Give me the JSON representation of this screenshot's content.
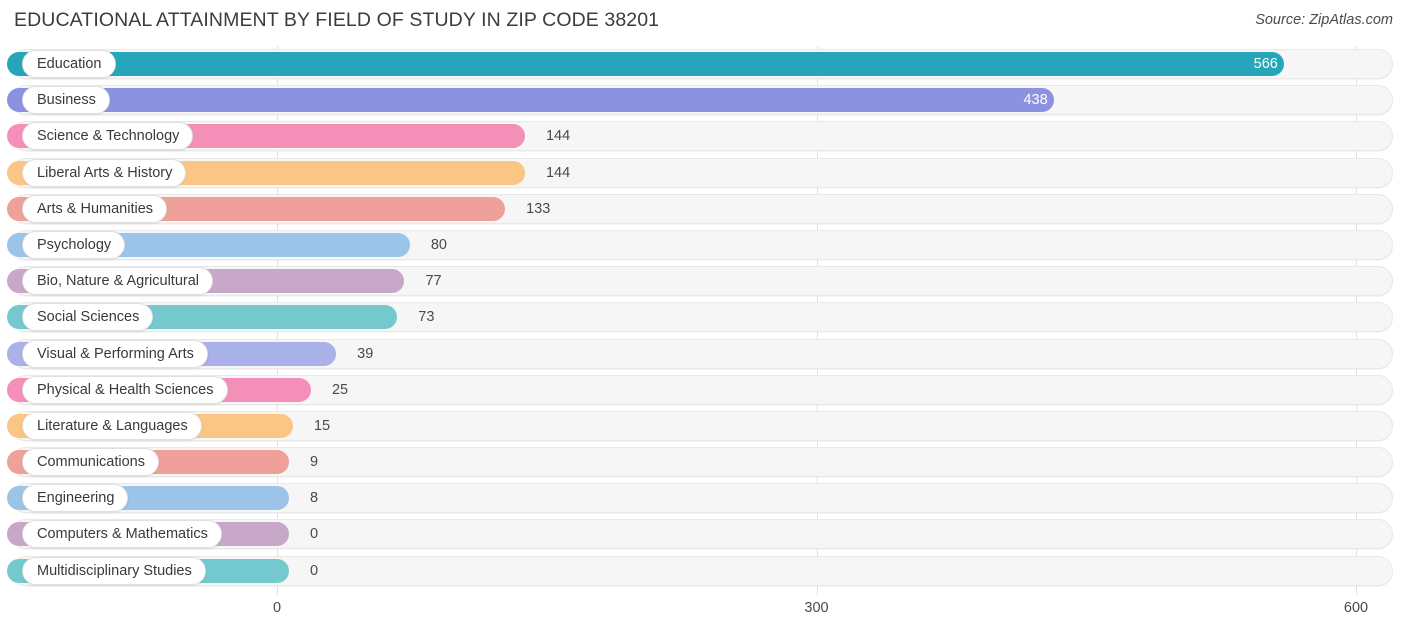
{
  "header": {
    "title": "EDUCATIONAL ATTAINMENT BY FIELD OF STUDY IN ZIP CODE 38201",
    "source": "Source: ZipAtlas.com"
  },
  "axis": {
    "ticks": [
      "0",
      "300",
      "600"
    ]
  },
  "chart_data": {
    "type": "bar",
    "orientation": "horizontal",
    "title": "EDUCATIONAL ATTAINMENT BY FIELD OF STUDY IN ZIP CODE 38201",
    "subtitle": "Source: ZipAtlas.com",
    "xlabel": "",
    "ylabel": "",
    "xlim": [
      0,
      600
    ],
    "xticks": [
      0,
      300,
      600
    ],
    "grid": true,
    "legend": false,
    "categories": [
      "Education",
      "Business",
      "Science & Technology",
      "Liberal Arts & History",
      "Arts & Humanities",
      "Psychology",
      "Bio, Nature & Agricultural",
      "Social Sciences",
      "Visual & Performing Arts",
      "Physical & Health Sciences",
      "Literature & Languages",
      "Communications",
      "Engineering",
      "Computers & Mathematics",
      "Multidisciplinary Studies"
    ],
    "values": [
      566,
      438,
      144,
      144,
      133,
      80,
      77,
      73,
      39,
      25,
      15,
      9,
      8,
      0,
      0
    ],
    "value_labels": [
      "566",
      "438",
      "144",
      "144",
      "133",
      "80",
      "77",
      "73",
      "39",
      "25",
      "15",
      "9",
      "8",
      "0",
      "0"
    ],
    "colors": [
      "#26a6b8",
      "#8b92e0",
      "#f490b8",
      "#fbc584",
      "#efa098",
      "#9cc3e8",
      "#c8a8c8",
      "#73c9ce",
      "#aab0e8",
      "#f490b8",
      "#fbc584",
      "#efa098",
      "#9cc3e8",
      "#c8a8c8",
      "#73c9ce"
    ],
    "label_inside": [
      true,
      true,
      false,
      false,
      false,
      false,
      false,
      false,
      false,
      false,
      false,
      false,
      false,
      false,
      false
    ]
  }
}
